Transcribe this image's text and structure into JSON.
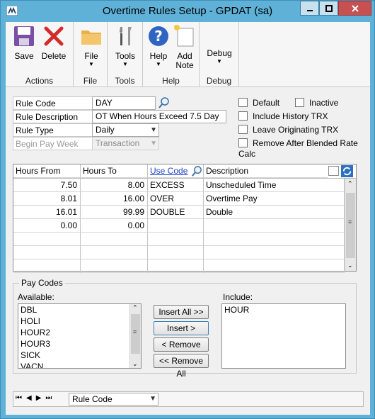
{
  "window": {
    "title": "Overtime Rules Setup  -  GPDAT (sa)"
  },
  "ribbon": {
    "save": "Save",
    "delete": "Delete",
    "actions_group": "Actions",
    "file": "File",
    "file_group": "File",
    "tools": "Tools",
    "tools_group": "Tools",
    "help": "Help",
    "add_note_1": "Add",
    "add_note_2": "Note",
    "help_group": "Help",
    "debug": "Debug",
    "debug_group": "Debug"
  },
  "form": {
    "rule_code_label": "Rule Code",
    "rule_code_value": "DAY",
    "rule_desc_label": "Rule Description",
    "rule_desc_value": "OT When Hours Exceed 7.5 Day",
    "rule_type_label": "Rule Type",
    "rule_type_value": "Daily",
    "begin_pay_week_label": "Begin Pay Week",
    "begin_pay_week_value": "Transaction",
    "default_label": "Default",
    "inactive_label": "Inactive",
    "include_history_label": "Include History TRX",
    "leave_originating_label": "Leave Originating TRX",
    "remove_after_label": "Remove After Blended Rate Calc"
  },
  "grid": {
    "headers": {
      "hours_from": "Hours From",
      "hours_to": "Hours To",
      "use_code": "Use Code",
      "description": "Description"
    },
    "rows": [
      {
        "from": "7.50",
        "to": "8.00",
        "code": "EXCESS",
        "desc": "Unscheduled Time"
      },
      {
        "from": "8.01",
        "to": "16.00",
        "code": "OVER",
        "desc": "Overtime Pay"
      },
      {
        "from": "16.01",
        "to": "99.99",
        "code": "DOUBLE",
        "desc": "Double"
      },
      {
        "from": "0.00",
        "to": "0.00",
        "code": "",
        "desc": ""
      },
      {
        "from": "",
        "to": "",
        "code": "",
        "desc": ""
      },
      {
        "from": "",
        "to": "",
        "code": "",
        "desc": ""
      },
      {
        "from": "",
        "to": "",
        "code": "",
        "desc": ""
      }
    ]
  },
  "paycodes": {
    "legend": "Pay Codes",
    "available_label": "Available:",
    "available": [
      "DBL",
      "HOLI",
      "HOUR2",
      "HOUR3",
      "SICK",
      "VACN"
    ],
    "include_label": "Include:",
    "include": [
      "HOUR"
    ],
    "insert_all": "Insert All >>",
    "insert": "Insert >",
    "remove": "< Remove",
    "remove_all": "<< Remove All"
  },
  "nav": {
    "sort_by": "Rule Code"
  },
  "colors": {
    "title_bg": "#5fb1d7",
    "close_btn": "#c75050",
    "link": "#1a3fc9"
  }
}
